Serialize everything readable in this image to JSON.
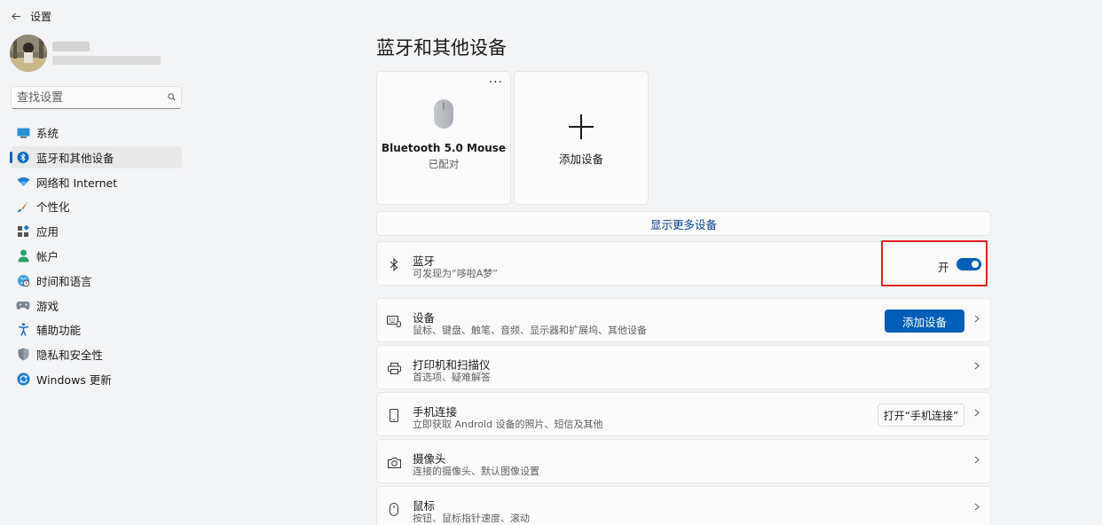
{
  "window": {
    "title": "设置",
    "back_icon": "back-arrow-icon"
  },
  "search": {
    "placeholder": "查找设置",
    "icon": "search-icon"
  },
  "sidebar": {
    "items": [
      {
        "label": "系统",
        "icon": "monitor-icon",
        "active": false
      },
      {
        "label": "蓝牙和其他设备",
        "icon": "bluetooth-icon",
        "active": true
      },
      {
        "label": "网络和 Internet",
        "icon": "wifi-icon",
        "active": false
      },
      {
        "label": "个性化",
        "icon": "brush-icon",
        "active": false
      },
      {
        "label": "应用",
        "icon": "apps-icon",
        "active": false
      },
      {
        "label": "帐户",
        "icon": "account-icon",
        "active": false
      },
      {
        "label": "时间和语言",
        "icon": "globe-clock-icon",
        "active": false
      },
      {
        "label": "游戏",
        "icon": "gamepad-icon",
        "active": false
      },
      {
        "label": "辅助功能",
        "icon": "accessibility-icon",
        "active": false
      },
      {
        "label": "隐私和安全性",
        "icon": "shield-icon",
        "active": false
      },
      {
        "label": "Windows 更新",
        "icon": "update-icon",
        "active": false
      }
    ]
  },
  "main": {
    "title": "蓝牙和其他设备",
    "device_tile": {
      "name": "Bluetooth 5.0 Mouse",
      "status": "已配对",
      "more_label": "···"
    },
    "add_tile": {
      "label": "添加设备"
    },
    "show_more": "显示更多设备",
    "bluetooth": {
      "title": "蓝牙",
      "subtitle": "可发现为“哆啦A梦”",
      "toggle_label": "开",
      "toggle_on": true
    },
    "rows": [
      {
        "title": "设备",
        "subtitle": "鼠标、键盘、触笔、音频、显示器和扩展坞、其他设备",
        "icon": "keyboard-icon",
        "button": "添加设备"
      },
      {
        "title": "打印机和扫描仪",
        "subtitle": "首选项、疑难解答",
        "icon": "printer-icon"
      },
      {
        "title": "手机连接",
        "subtitle": "立即获取 Android 设备的照片、短信及其他",
        "icon": "phone-icon",
        "button": "打开“手机连接”"
      },
      {
        "title": "摄像头",
        "subtitle": "连接的摄像头、默认图像设置",
        "icon": "camera-icon"
      },
      {
        "title": "鼠标",
        "subtitle": "按钮、鼠标指针速度、滚动",
        "icon": "mouse-icon"
      }
    ]
  },
  "colors": {
    "accent": "#005fb8",
    "highlight": "#e0201d",
    "link": "#003e92"
  }
}
